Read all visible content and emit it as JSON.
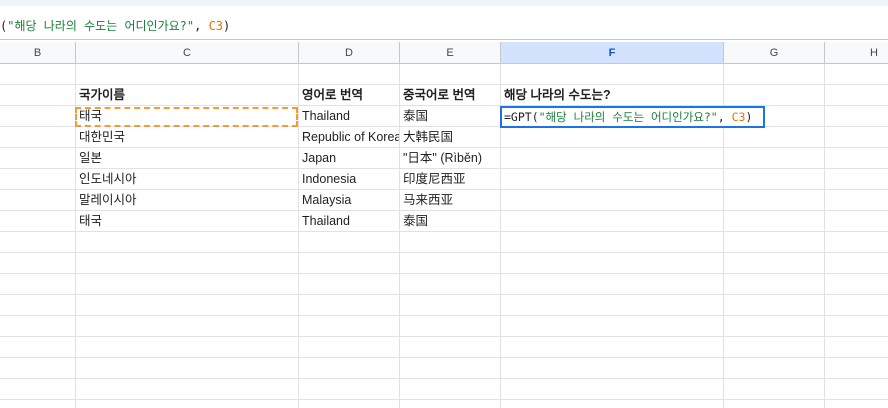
{
  "formula_bar": {
    "open_paren": "(",
    "string_arg": "\"해당 나라의 수도는 어디인가요?\"",
    "sep": ", ",
    "ref_arg": "C3",
    "close_paren": ")"
  },
  "columns": [
    "B",
    "C",
    "D",
    "E",
    "F",
    "G",
    "H"
  ],
  "active_column": "F",
  "headers": {
    "country": "국가이름",
    "english": "영어로 번역",
    "chinese": "중국어로 번역",
    "capital": "해당 나라의 수도는?"
  },
  "rows": [
    {
      "country": "태국",
      "english": "Thailand",
      "chinese": "泰国"
    },
    {
      "country": "대한민국",
      "english": "Republic of Korea",
      "chinese": "大韩民国"
    },
    {
      "country": "일본",
      "english": "Japan",
      "chinese": "\"日本\" (Rìběn)"
    },
    {
      "country": "인도네시아",
      "english": "Indonesia",
      "chinese": "印度尼西亚"
    },
    {
      "country": "말레이시아",
      "english": "Malaysia",
      "chinese": "马来西亚"
    },
    {
      "country": "태국",
      "english": "Thailand",
      "chinese": "泰国"
    }
  ],
  "editor": {
    "fn": "=GPT(",
    "string_arg": "\"해당 나라의 수도는 어디인가요?\"",
    "sep": ", ",
    "ref_arg": "C3",
    "close_paren": ")"
  }
}
